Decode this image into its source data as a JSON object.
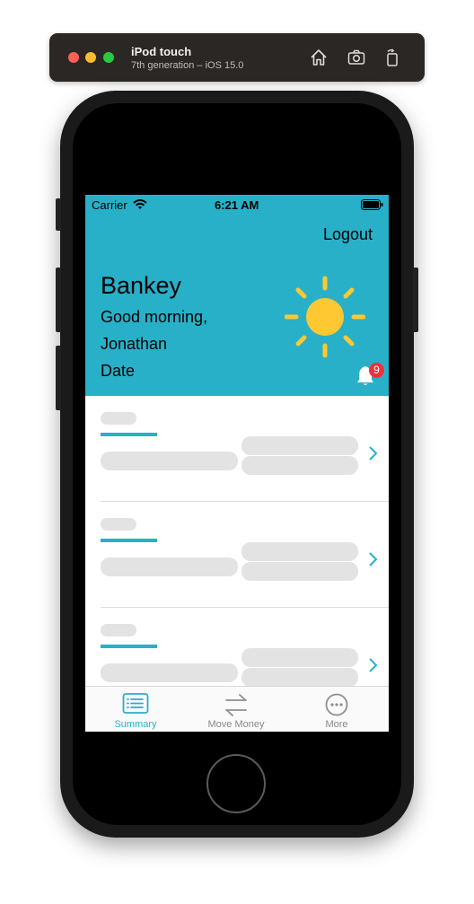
{
  "simulator": {
    "device_name": "iPod touch",
    "device_detail": "7th generation – iOS 15.0"
  },
  "status_bar": {
    "carrier": "Carrier",
    "time": "6:21 AM"
  },
  "header": {
    "logout_label": "Logout",
    "app_name": "Bankey",
    "greeting": "Good morning,",
    "user_name": "Jonathan",
    "date_label": "Date",
    "notification_count": "9",
    "background_color": "#28b0c8",
    "sun_color": "#fdc832"
  },
  "accounts": {
    "row_count_visible": 3,
    "accent_color": "#28b0c8"
  },
  "tab_bar": {
    "tabs": [
      {
        "label": "Summary",
        "icon": "list-icon",
        "selected": true
      },
      {
        "label": "Move Money",
        "icon": "arrows-left-right-icon",
        "selected": false
      },
      {
        "label": "More",
        "icon": "ellipsis-circle-icon",
        "selected": false
      }
    ]
  }
}
